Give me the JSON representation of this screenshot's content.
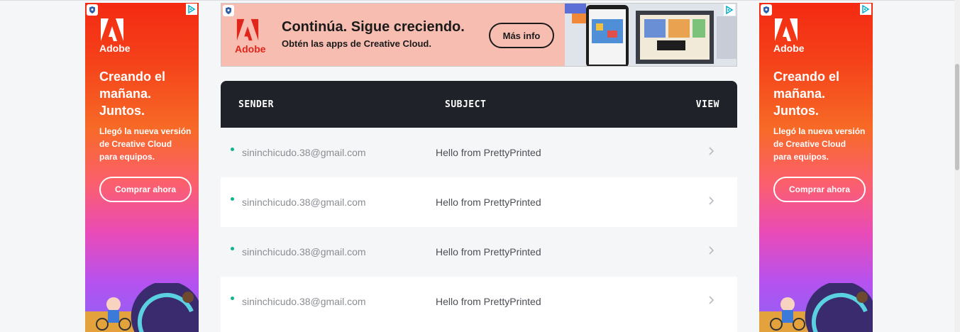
{
  "side_ads": {
    "brand": "Adobe",
    "headline": "Creando el mañana. Juntos.",
    "body": "Llegó la nueva versión de Creative Cloud para equipos.",
    "cta": "Comprar ahora"
  },
  "banner_ad": {
    "brand": "Adobe",
    "title": "Continúa. Sigue creciendo.",
    "subtitle": "Obtén las apps de Creative Cloud.",
    "cta": "Más info"
  },
  "inbox": {
    "columns": {
      "sender": "SENDER",
      "subject": "SUBJECT",
      "view": "VIEW"
    },
    "rows": [
      {
        "sender": "sininchicudo.38@gmail.com",
        "subject": "Hello from PrettyPrinted"
      },
      {
        "sender": "sininchicudo.38@gmail.com",
        "subject": "Hello from PrettyPrinted"
      },
      {
        "sender": "sininchicudo.38@gmail.com",
        "subject": "Hello from PrettyPrinted"
      },
      {
        "sender": "sininchicudo.38@gmail.com",
        "subject": "Hello from PrettyPrinted"
      }
    ]
  },
  "colors": {
    "header_bg": "#1f2228",
    "unread_dot": "#10b48a",
    "adobe_red": "#e1251b"
  },
  "icons": [
    "ad-shield-icon",
    "ad-choices-icon",
    "adobe-logo-icon",
    "chevron-right-icon"
  ]
}
